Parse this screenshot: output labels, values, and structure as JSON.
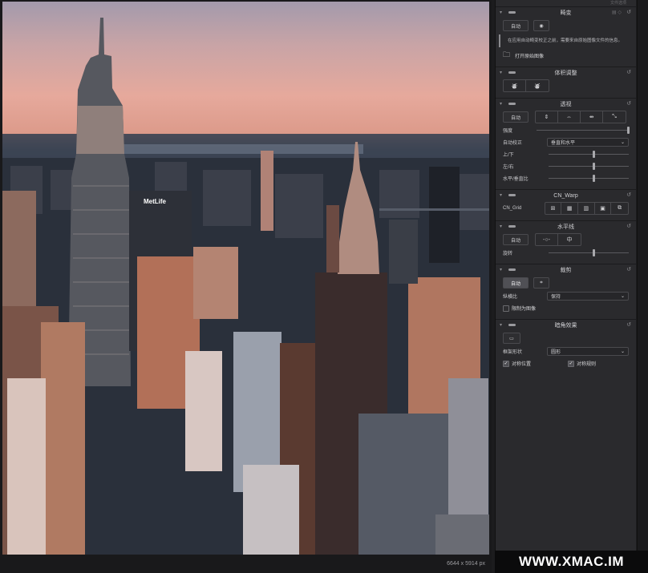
{
  "canvas": {
    "image_info": "6644 x 5914 px",
    "photo_sign": "MetLife"
  },
  "panel": {
    "top_label": "文件选项",
    "distortion": {
      "title": "畸变",
      "auto_label": "自动",
      "info_text": "在应用自动畸变校正之前，需要来自原始图像文件的信息。",
      "open_raw_label": "打开原始图像"
    },
    "lens_geometry": {
      "title": "体积调整"
    },
    "perspective": {
      "title": "透视",
      "auto_label": "自动",
      "strength_label": "强度",
      "auto_correct_label": "自动校正",
      "auto_correct_value": "垂直和水平",
      "vertical_label": "上/下",
      "horizontal_label": "左/右",
      "ratio_label": "水平/垂直比"
    },
    "warp": {
      "title": "CN_Warp",
      "grid_label": "CN_Grid"
    },
    "horizon": {
      "title": "水平线",
      "auto_label": "自动",
      "rotate_label": "旋转"
    },
    "crop": {
      "title": "裁剪",
      "auto_label": "自动",
      "aspect_label": "纵横比",
      "aspect_value": "保持",
      "limit_label": "限制为图像"
    },
    "vignette": {
      "title": "暗角效果",
      "shape_label": "框架形状",
      "shape_value": "圆形",
      "sym_pos_label": "对称位置",
      "sym_size_label": "对称规则"
    }
  },
  "watermark": "WWW.XMAC.IM"
}
